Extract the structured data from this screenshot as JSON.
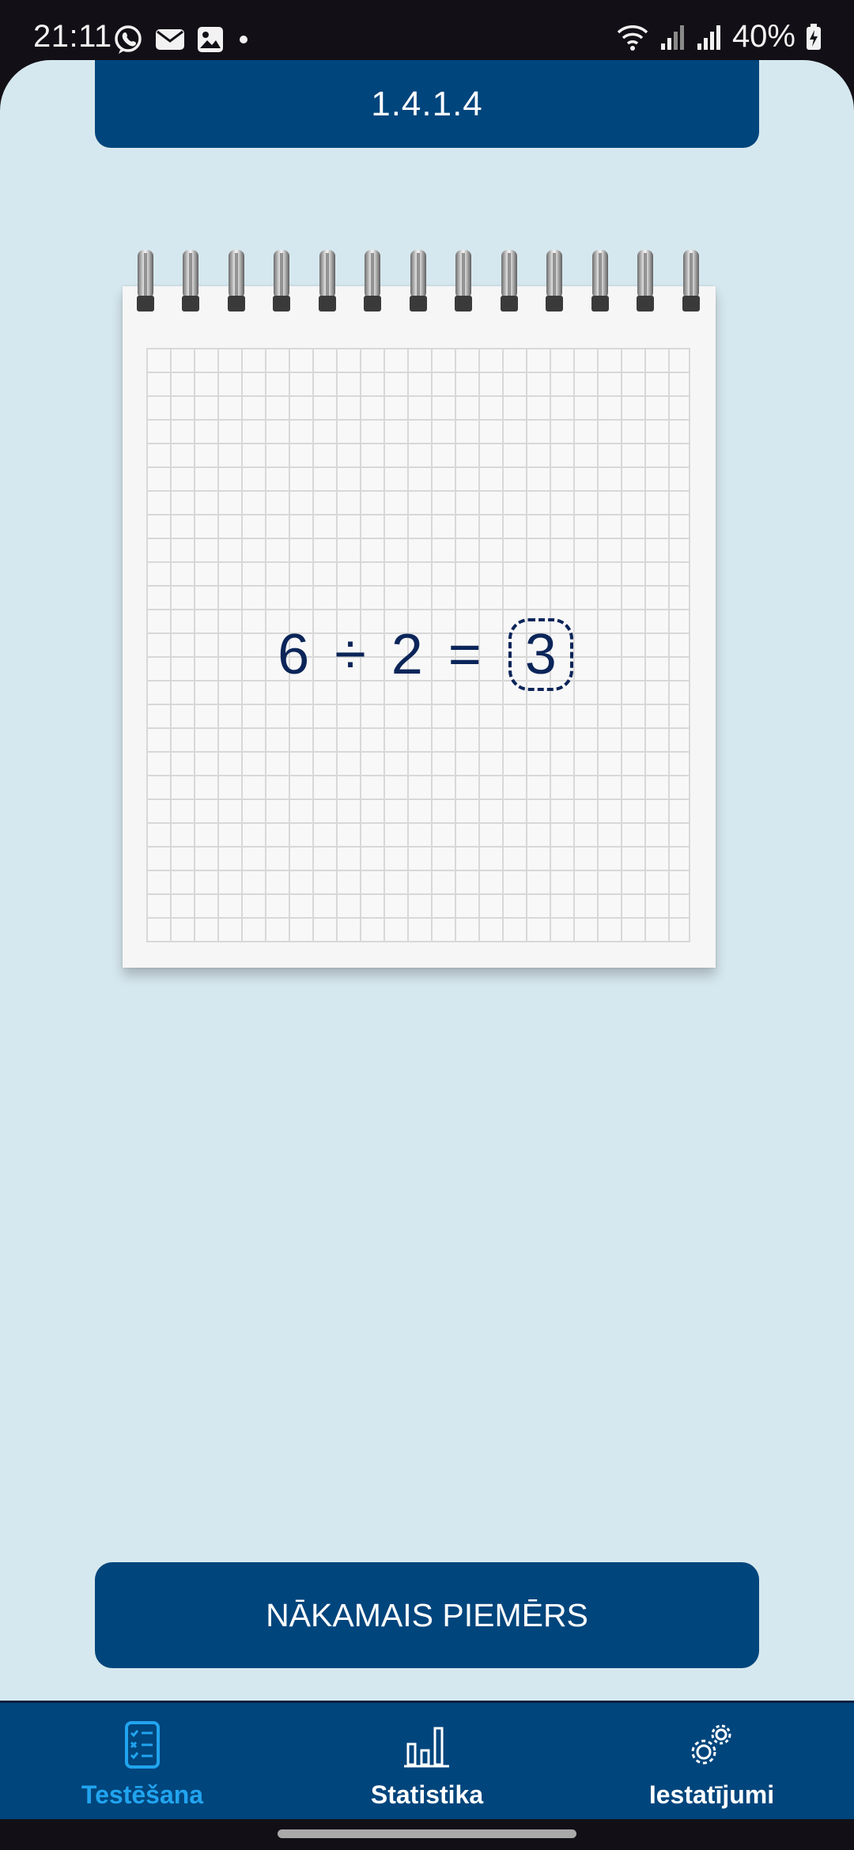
{
  "status_bar": {
    "time": "21:11",
    "battery": "40%",
    "left_icons": [
      "viber-icon",
      "mail-icon",
      "gallery-icon",
      "dot-icon"
    ],
    "right_icons": [
      "wifi-icon",
      "signal-icon",
      "signal-icon",
      "battery-charging-icon"
    ]
  },
  "header": {
    "title": "1.4.1.4"
  },
  "exercise": {
    "operand_a": "6",
    "operator": "÷",
    "operand_b": "2",
    "equals": "=",
    "answer": "3"
  },
  "next_button": {
    "label": "NĀKAMAIS PIEMĒRS"
  },
  "bottom_nav": {
    "items": [
      {
        "label": "Testēšana",
        "icon": "checklist-icon",
        "active": true
      },
      {
        "label": "Statistika",
        "icon": "bar-chart-icon",
        "active": false
      },
      {
        "label": "Iestatījumi",
        "icon": "gears-icon",
        "active": false
      }
    ]
  },
  "colors": {
    "primary": "#00457c",
    "background": "#d6e8ef",
    "active_tab": "#21a4ef",
    "equation_text": "#0b2559"
  }
}
